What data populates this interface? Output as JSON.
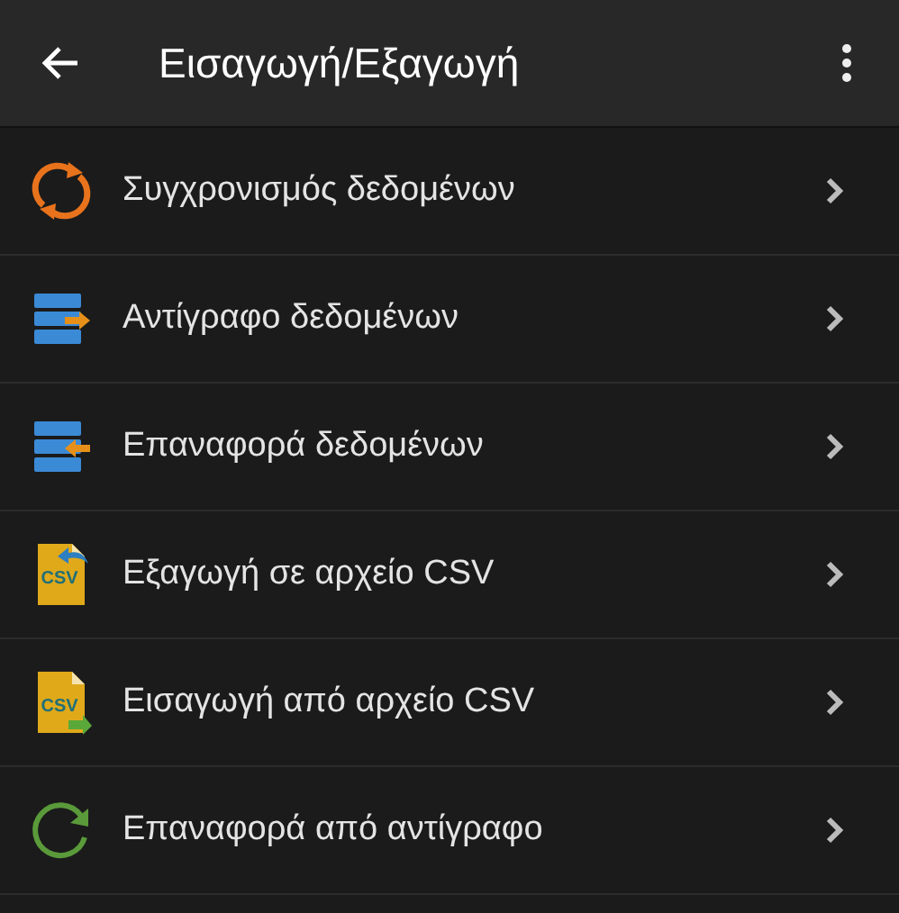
{
  "app_bar": {
    "title": "Εισαγωγή/Εξαγωγή"
  },
  "items": [
    {
      "kind": "sync",
      "label": "Συγχρονισμός δεδομένων"
    },
    {
      "kind": "backup",
      "label": "Αντίγραφο δεδομένων"
    },
    {
      "kind": "restore",
      "label": "Επαναφορά δεδομένων"
    },
    {
      "kind": "csv_export",
      "label": "Εξαγωγή σε αρχείο CSV",
      "icon_text": "CSV"
    },
    {
      "kind": "csv_import",
      "label": "Εισαγωγή από αρχείο CSV",
      "icon_text": "CSV"
    },
    {
      "kind": "restore_backup",
      "label": "Επαναφορά από αντίγραφο"
    }
  ]
}
